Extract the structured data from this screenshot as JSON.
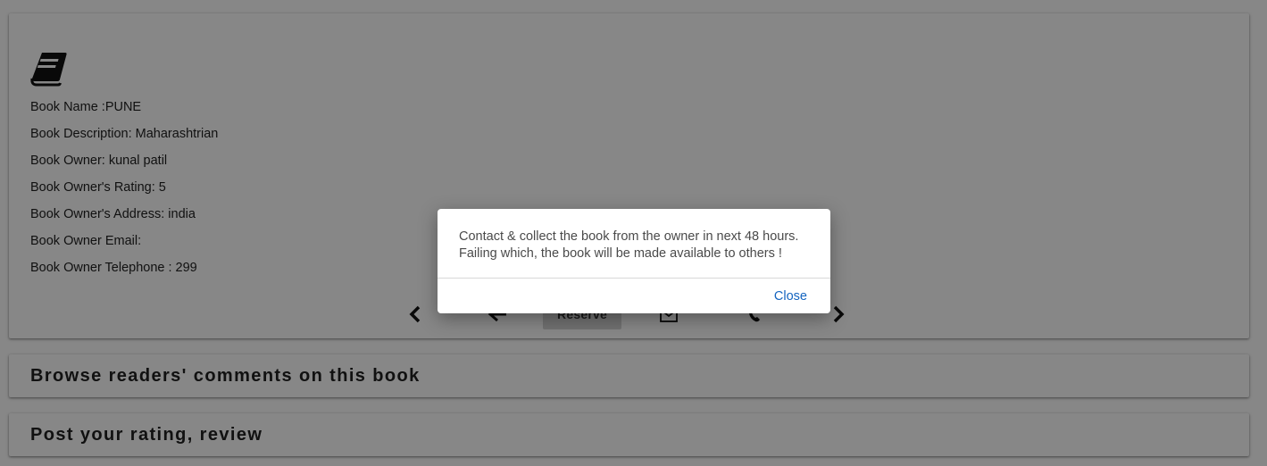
{
  "book": {
    "name_line": "Book Name :PUNE",
    "description_line": "Book Description: Maharashtrian",
    "owner_line": "Book Owner: kunal patil",
    "rating_line": "Book Owner's Rating: 5",
    "address_line": "Book Owner's Address: india",
    "email_line": "Book Owner Email:",
    "telephone_line": "Book Owner Telephone : 299"
  },
  "actions": {
    "reserve_label": "Reserve",
    "icons": [
      "chevron-left-icon",
      "arrow-left-icon",
      "mail-icon",
      "phone-icon",
      "chevron-right-icon"
    ]
  },
  "sections": {
    "comments_title": "Browse readers' comments on this book",
    "post_title": "Post your rating, review"
  },
  "dialog": {
    "line1": "Contact & collect the book from the owner in next 48 hours.",
    "line2": "Failing which, the book will be made available to others !",
    "close_label": "Close"
  },
  "colors": {
    "overlay": "rgba(0,0,0,0.47)",
    "link": "#1565c0"
  }
}
